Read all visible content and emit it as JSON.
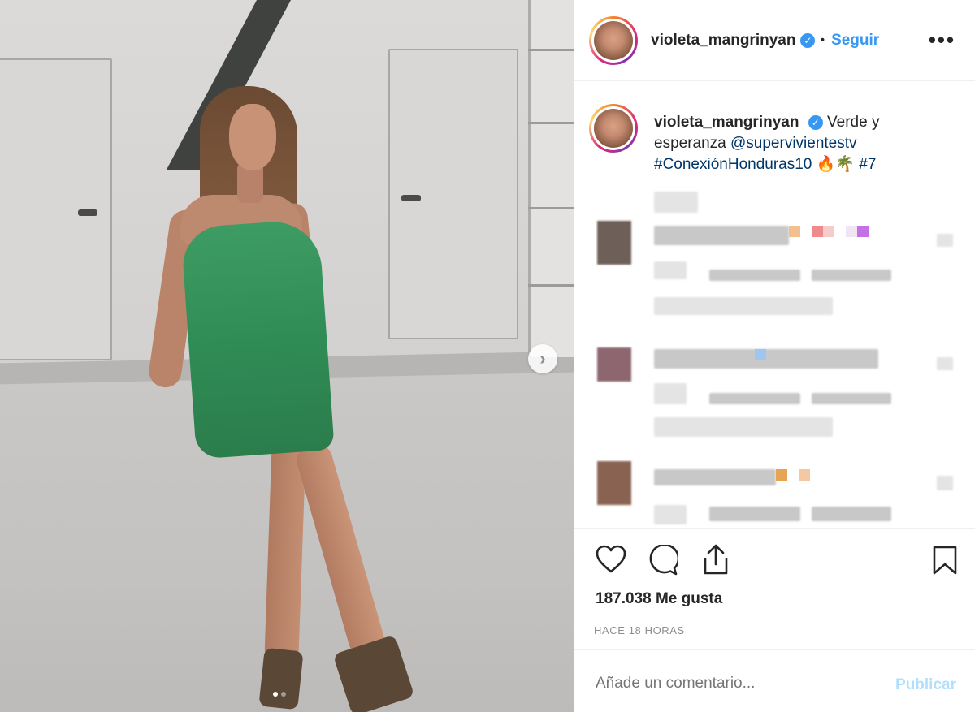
{
  "post": {
    "username": "violeta_mangrinyan",
    "follow_label": "Seguir",
    "separator": "•",
    "more_label": "•••"
  },
  "caption": {
    "username": "violeta_mangrinyan",
    "text_plain": "Verde y esperanza",
    "mention": "@supervivientestv",
    "hashtag1": "#ConexiónHonduras10",
    "emojis": "🔥🌴",
    "hashtag2": "#7"
  },
  "carousel": {
    "next_label": "›"
  },
  "engagement": {
    "likes": "187.038 Me gusta",
    "timestamp": "HACE 18 HORAS"
  },
  "comment_box": {
    "placeholder": "Añade un comentario...",
    "publish_label": "Publicar"
  },
  "colors": {
    "accent": "#3897f0",
    "link": "#003569",
    "publish_disabled": "#b2dffc",
    "text": "#262626",
    "muted": "#8e8e8e"
  },
  "icons": [
    "heart-icon",
    "comment-icon",
    "share-icon",
    "bookmark-icon",
    "verified-icon",
    "more-icon",
    "chevron-right-icon"
  ]
}
